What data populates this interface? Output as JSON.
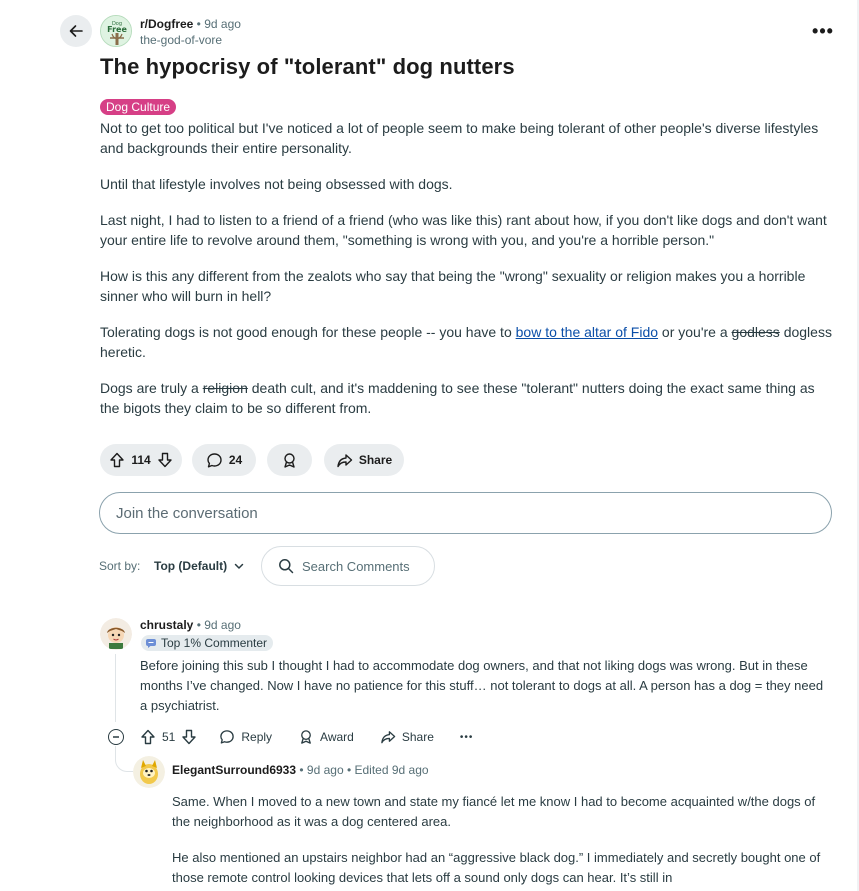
{
  "header": {
    "subreddit": "r/Dogfree",
    "separator": " • ",
    "time_ago": "9d ago",
    "author": "the-god-of-vore",
    "more_label": "•••"
  },
  "post": {
    "title": "The hypocrisy of \"tolerant\" dog nutters",
    "flair": "Dog Culture",
    "paragraphs": {
      "p1": "Not to get too political but I've noticed a lot of people seem to make being tolerant of other people's diverse lifestyles and backgrounds their entire personality.",
      "p2": "Until that lifestyle involves not being obsessed with dogs.",
      "p3": "Last night, I had to listen to a friend of a friend (who was like this) rant about how, if you don't like dogs and don't want your entire life to revolve around them, \"something is wrong with you, and you're a horrible person.\"",
      "p4": "How is this any different from the zealots who say that being the \"wrong\" sexuality or religion makes you a horrible sinner who will burn in hell?",
      "p5_a": "Tolerating dogs is not good enough for these people -- you have to ",
      "p5_link": "bow to the altar of Fido",
      "p5_b": " or you're a ",
      "p5_strike": "godless",
      "p5_c": " dogless heretic.",
      "p6_a": "Dogs are truly a ",
      "p6_strike": "religion",
      "p6_b": " death cult, and it's maddening to see these \"tolerant\" nutters doing the exact same thing as the bigots they claim to be so different from."
    },
    "votes": "114",
    "comments_count": "24",
    "share_label": "Share"
  },
  "comment_box": {
    "placeholder": "Join the conversation"
  },
  "sort": {
    "label": "Sort by:",
    "value": "Top (Default)",
    "search_placeholder": "Search Comments"
  },
  "comments": [
    {
      "user": "chrustaly",
      "time": "9d ago",
      "badge": "Top 1% Commenter",
      "text": "Before joining this sub I thought I had to accommodate dog owners, and that not liking dogs was wrong. But in these months I’ve changed. Now I have no patience for this stuff… not tolerant to dogs at all. A person has a dog = they need a psychiatrist.",
      "votes": "51",
      "reply_label": "Reply",
      "award_label": "Award",
      "share_label": "Share",
      "more_label": "•••"
    },
    {
      "user": "ElegantSurround6933",
      "time": "9d ago",
      "edited": "Edited 9d ago",
      "text_p1": "Same. When I moved to a new town and state my fiancé let me know I had to become acquainted w/the dogs of the neighborhood as it was a dog centered area.",
      "text_p2": "He also mentioned an upstairs neighbor had an “aggressive black dog.” I immediately and secretly bought one of those remote control looking devices that lets off a sound only dogs can hear. It’s still in"
    }
  ],
  "colors": {
    "flair_bg": "#d63f86",
    "pill_bg": "#eaedef",
    "link": "#0a4ea8"
  }
}
